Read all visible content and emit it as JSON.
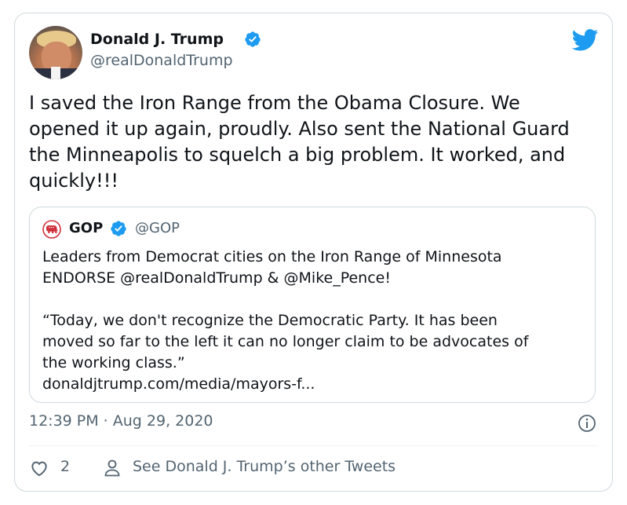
{
  "author": {
    "name": "Donald J. Trump",
    "handle": "@realDonaldTrump"
  },
  "tweet": {
    "text": "I saved the Iron Range from the Obama Closure. We opened it up again, proudly. Also sent the National Guard the Minneapolis to squelch a big problem. It worked, and quickly!!!"
  },
  "quote": {
    "name": "GOP",
    "handle": "@GOP",
    "line1": "Leaders from Democrat cities on the Iron Range of Minnesota",
    "line2": "ENDORSE @realDonaldTrump & @Mike_Pence!",
    "line3": "“Today, we don't recognize the Democratic Party. It has been",
    "line4": "moved so far to the left it can no longer claim to be advocates of",
    "line5": "the working class.”",
    "line6": "donaldjtrump.com/media/mayors-f..."
  },
  "meta": {
    "timestamp": "12:39 PM · Aug 29, 2020"
  },
  "actions": {
    "like_count": "2",
    "see_more_label": "See Donald J. Trump’s other Tweets"
  },
  "colors": {
    "twitter_blue": "#1d9bf0",
    "text_primary": "#0f1419",
    "text_secondary": "#536471",
    "border": "#cfd9de",
    "gop_red": "#d0313b"
  },
  "icons": [
    "verified-badge-icon",
    "twitter-bird-icon",
    "gop-elephant-icon",
    "info-icon",
    "heart-icon",
    "person-icon"
  ]
}
